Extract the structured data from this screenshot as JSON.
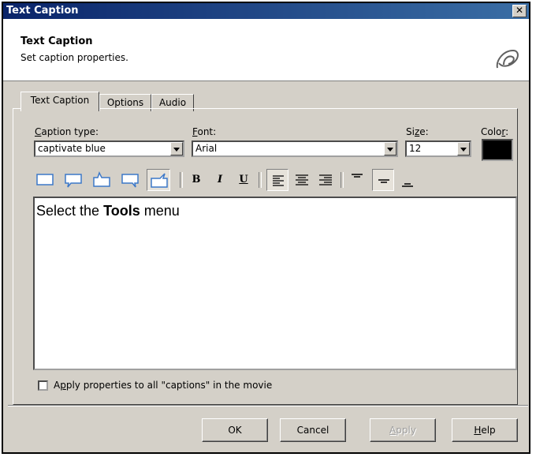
{
  "window": {
    "title": "Text Caption",
    "close_symbol": "✕"
  },
  "header": {
    "title": "Text Caption",
    "subtitle": "Set caption properties."
  },
  "tabs": [
    {
      "label": "Text Caption",
      "active": true
    },
    {
      "label": "Options",
      "active": false
    },
    {
      "label": "Audio",
      "active": false
    }
  ],
  "caption_type": {
    "label_prefix": "C",
    "label_rest": "aption type:",
    "value": "captivate blue"
  },
  "font": {
    "label_prefix": "F",
    "label_rest": "ont:",
    "value": "Arial"
  },
  "size": {
    "label_prefix": "Si",
    "label_mid": "z",
    "label_rest": "e:",
    "value": "12"
  },
  "color": {
    "label_prefix": "Colo",
    "label_mid": "r",
    "label_rest": ":",
    "value": "#000000"
  },
  "toolbar": {
    "bold": "B",
    "italic": "I",
    "underline": "U",
    "callout_shapes": [
      "rectangle",
      "callout-bottom-left",
      "callout-top",
      "callout-bottom-right",
      "callout-top-right"
    ],
    "selected_shape_index": 4,
    "align_selected": "left",
    "valign_selected": "middle"
  },
  "editor": {
    "text_before": "Select the ",
    "text_bold": "Tools",
    "text_after": " menu"
  },
  "apply_all": {
    "label_prefix": "A",
    "label_mid": "p",
    "label_rest": "ply properties to all \"captions\" in the movie",
    "checked": false
  },
  "buttons": {
    "ok": "OK",
    "cancel": "Cancel",
    "apply_prefix": "A",
    "apply_rest": "pply",
    "help_prefix": "H",
    "help_rest": "elp"
  },
  "accent_color": "#0a246a",
  "icon_color": "#3c78c8"
}
